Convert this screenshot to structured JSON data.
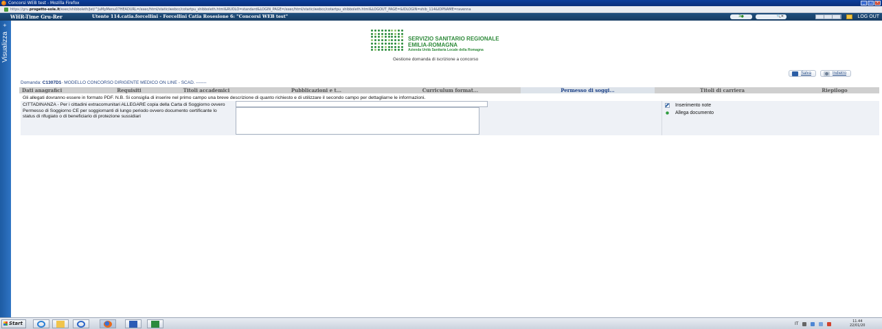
{
  "window": {
    "title": "Concorsi WEB test - Mozilla Firefox",
    "controls": [
      "_",
      "□",
      "×"
    ]
  },
  "browser": {
    "url_prefix": "https://gru.",
    "url_host": "progetto-sole.it",
    "url_rest": "/exec/shibboleth/Jet/^JuMpMenu07HEADURL=/exec/html/static/webcc/cotartpu_shibboleth.html&RUOLO=standard&LOGIN_PAGE=/exec/html/static/webcc/cotartpu_shibboleth.html&LOGOUT_PAGE=&IDLOGIN=shib_114&IDPNAME=ravenna"
  },
  "appbar": {
    "app_name": "WHR-Time Gru-Rer",
    "user_info": "Utente 114.catia.forcellini - Forcellini Catia Ro𝘀esione 6: \"Concorsi WEB test\"",
    "green_badge": "3●",
    "search_hint": "🔍✕",
    "logout": "LOG OUT"
  },
  "sidebar": {
    "plus": "+",
    "label": "Visualizza"
  },
  "logo": {
    "line1": "SERVIZIO SANITARIO REGIONALE",
    "line2": "EMILIA-ROMAGNA",
    "line3": "Azienda Unità Sanitaria Locale della Romagna"
  },
  "page": {
    "subtitle": "Gestione domanda di iscrizione a concorso",
    "domanda_prefix": "Domanda: ",
    "domanda_code": "C1307D1",
    "domanda_rest": "- MODELLO CONCORSO DIRIGENTE MEDICO ON LINE - SCAD. -------"
  },
  "actions": {
    "save": "Salva",
    "back": "Indietro"
  },
  "tabs": [
    {
      "label": "Dati anagrafici",
      "active": false
    },
    {
      "label": "Requisiti",
      "active": false
    },
    {
      "label": "Titoli accademici",
      "active": false
    },
    {
      "label": "Pubblicazioni e t...",
      "active": false
    },
    {
      "label": "Curriculum format...",
      "active": false
    },
    {
      "label": "Permesso di soggi...",
      "active": true
    },
    {
      "label": "Titoli di carriera",
      "active": false
    },
    {
      "label": "Riepilogo",
      "active": false
    }
  ],
  "form": {
    "note": "Gli allegati dovranno essere in formato PDF. N.B. Si consiglia di inserire nel primo campo una breve descrizione di quanto richiesto e di utilizzare il secondo campo per dettagliarne le informazioni.",
    "field_label": "CITTADINANZA - Per i cittadini extracomunitari ALLEGARE copia della Carta di Soggiorno ovvero Permesso di Soggiorno CE per soggiornanti di lungo periodo ovvero documento certificante lo status di rifugiato o di beneficiario di protezione sussidiari",
    "short_value": "",
    "long_value": ""
  },
  "right_panel": {
    "notes": "Inserimento note",
    "attach": "Allega documento"
  },
  "taskbar": {
    "start": "Start",
    "lang": "IT",
    "time": "11.44",
    "date": "22/01/20"
  }
}
